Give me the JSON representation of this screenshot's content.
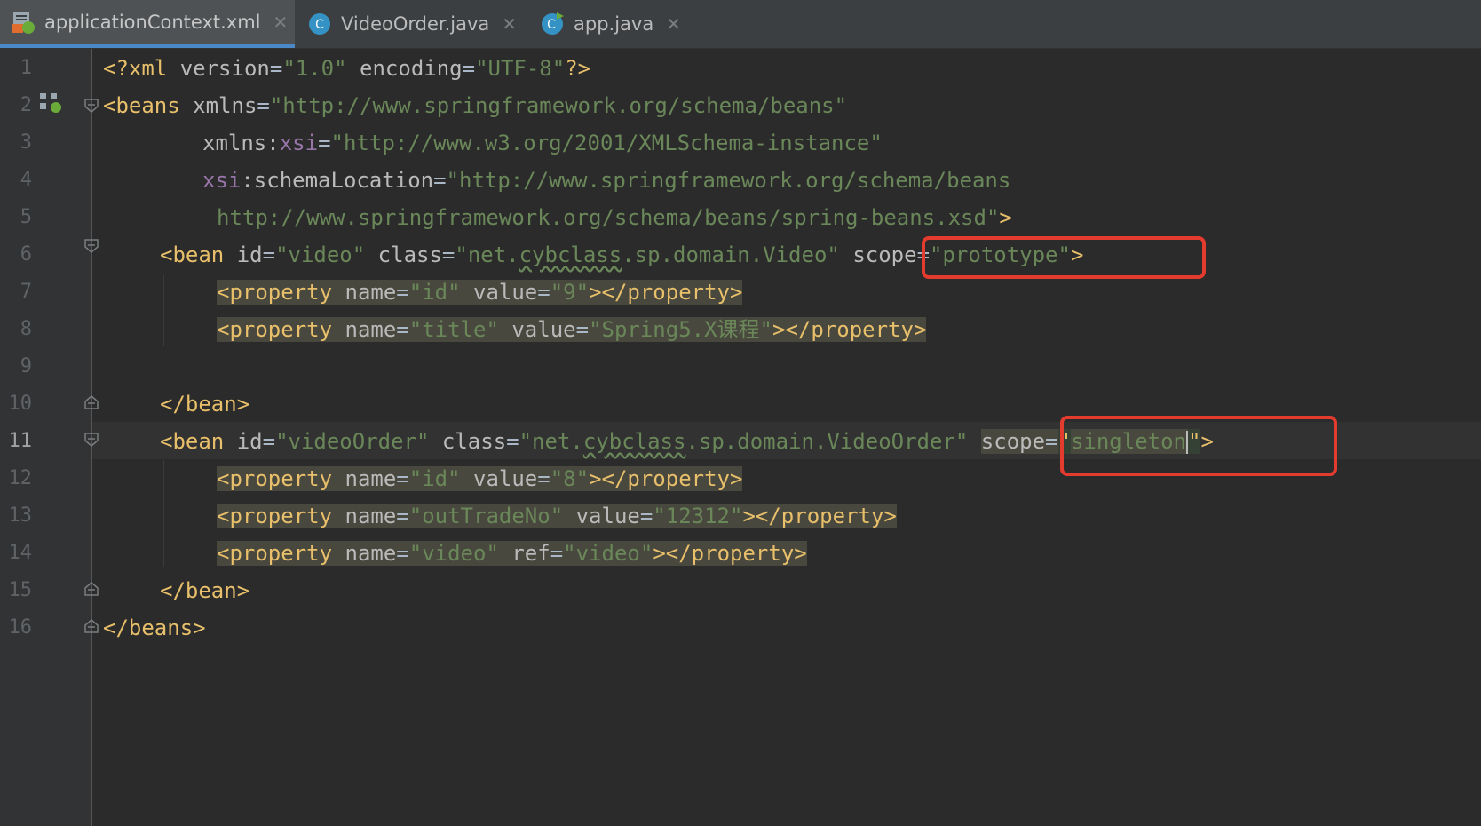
{
  "tabs": [
    {
      "label": "applicationContext.xml",
      "icon": "xml-spring-file-icon",
      "active": true
    },
    {
      "label": "VideoOrder.java",
      "icon": "java-class-icon",
      "active": false
    },
    {
      "label": "app.java",
      "icon": "java-runnable-class-icon",
      "active": false
    }
  ],
  "gutter": {
    "line_numbers": [
      "1",
      "2",
      "3",
      "4",
      "5",
      "6",
      "7",
      "8",
      "9",
      "10",
      "11",
      "12",
      "13",
      "14",
      "15",
      "16"
    ],
    "current_line": "11"
  },
  "code": {
    "l1": {
      "a": "<?xml ",
      "b": "version",
      "c": "=",
      "d": "\"1.0\"",
      "e": " ",
      "f": "encoding",
      "g": "=",
      "h": "\"UTF-8\"",
      "i": "?>"
    },
    "l2": {
      "a": "<beans ",
      "b": "xmlns",
      "c": "=",
      "d": "\"http://www.springframework.org/schema/beans\""
    },
    "l3": {
      "a": "xmlns:",
      "b": "xsi",
      "c": "=",
      "d": "\"http://www.w3.org/2001/XMLSchema-instance\""
    },
    "l4": {
      "a": "xsi",
      "b": ":schemaLocation",
      "c": "=",
      "d": "\"http://www.springframework.org/schema/beans"
    },
    "l5": {
      "a": "http://www.springframework.org/schema/beans/spring-beans.xsd\"",
      "b": ">"
    },
    "l6": {
      "a": "<bean ",
      "b": "id",
      "c": "=",
      "d": "\"video\"",
      "e": " ",
      "f": "class",
      "g": "=",
      "h1": "\"net.",
      "h2": "cybclass",
      ".h3": "",
      "h3": ".sp.domain.Video\"",
      "i": " ",
      "j": "scope",
      "k": "=",
      "l": "\"prototype\"",
      "m": ">"
    },
    "l7": {
      "a": "<property ",
      "b": "name",
      "c": "=",
      "d": "\"id\"",
      "e": " ",
      "f": "value",
      "g": "=",
      "h": "\"9\"",
      "i": "></property>"
    },
    "l8": {
      "a": "<property ",
      "b": "name",
      "c": "=",
      "d": "\"title\"",
      "e": " ",
      "f": "value",
      "g": "=",
      "h": "\"Spring5.X课程\"",
      "i": "></property>"
    },
    "l10": {
      "a": "</bean>"
    },
    "l11": {
      "a": "<bean ",
      "b": "id",
      "c": "=",
      "d": "\"videoOrder\"",
      "e": " ",
      "f": "class",
      "g": "=",
      "h1": "\"net.",
      "h2": "cybclass",
      "h3": ".sp.domain.VideoOrder\"",
      "i": " ",
      "j": "scope",
      "k": "=",
      "l1": "\"",
      "l2": "singleton",
      "l3": "\"",
      "m": ">"
    },
    "l12": {
      "a": "<property ",
      "b": "name",
      "c": "=",
      "d": "\"id\"",
      "e": " ",
      "f": "value",
      "g": "=",
      "h": "\"8\"",
      "i": "></property>"
    },
    "l13": {
      "a": "<property ",
      "b": "name",
      "c": "=",
      "d": "\"outTradeNo\"",
      "e": " ",
      "f": "value",
      "g": "=",
      "h": "\"12312\"",
      "i": "></property>"
    },
    "l14": {
      "a": "<property ",
      "b": "name",
      "c": "=",
      "d": "\"video\"",
      "e": " ",
      "f": "ref",
      "g": "=",
      "h": "\"video\"",
      "i": "></property>"
    },
    "l15": {
      "a": "</bean>"
    },
    "l16": {
      "a": "</beans>"
    }
  },
  "colors": {
    "editor_bg": "#2b2b2b",
    "tag": "#e8bf6a",
    "attribute": "#bababa",
    "namespace": "#9876aa",
    "string": "#6a8759",
    "highlight_box": "#e33b2e"
  }
}
